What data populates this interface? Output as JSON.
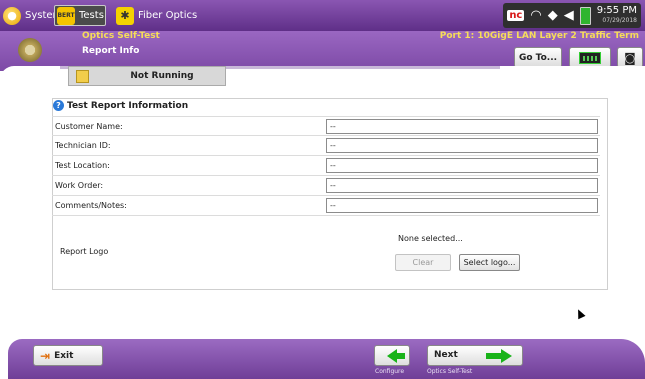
{
  "system_bar": {
    "tabs": [
      {
        "label": "System",
        "icon": "system-orb-icon"
      },
      {
        "label": "Tests",
        "icon": "bert-icon",
        "icon_text": "BERT"
      },
      {
        "label": "Fiber Optics",
        "icon": "fiber-star-icon"
      }
    ],
    "status": {
      "nc_badge": "nc",
      "time": "9:55 PM",
      "date": "07/29/2018"
    }
  },
  "header": {
    "subtitle": "Optics Self-Test",
    "title": "Report Info",
    "port_info": "Port 1: 10GigE LAN Layer 2 Traffic Term",
    "goto_label": "Go To..."
  },
  "run_status": {
    "label": "Not Running"
  },
  "form": {
    "section_title": "Test Report Information",
    "fields": [
      {
        "label": "Customer Name:",
        "value": "--"
      },
      {
        "label": "Technician ID:",
        "value": "--"
      },
      {
        "label": "Test Location:",
        "value": "--"
      },
      {
        "label": "Work Order:",
        "value": "--"
      },
      {
        "label": "Comments/Notes:",
        "value": "--"
      }
    ],
    "logo": {
      "label": "Report Logo",
      "status": "None selected...",
      "clear_label": "Clear",
      "select_label": "Select logo..."
    }
  },
  "footer": {
    "exit_label": "Exit",
    "back_caption": "Configure",
    "next_label": "Next",
    "next_caption": "Optics Self-Test"
  },
  "colors": {
    "header_purple": "#7d4aa6",
    "accent_yellow": "#f6dd58",
    "nav_green": "#19b319"
  }
}
